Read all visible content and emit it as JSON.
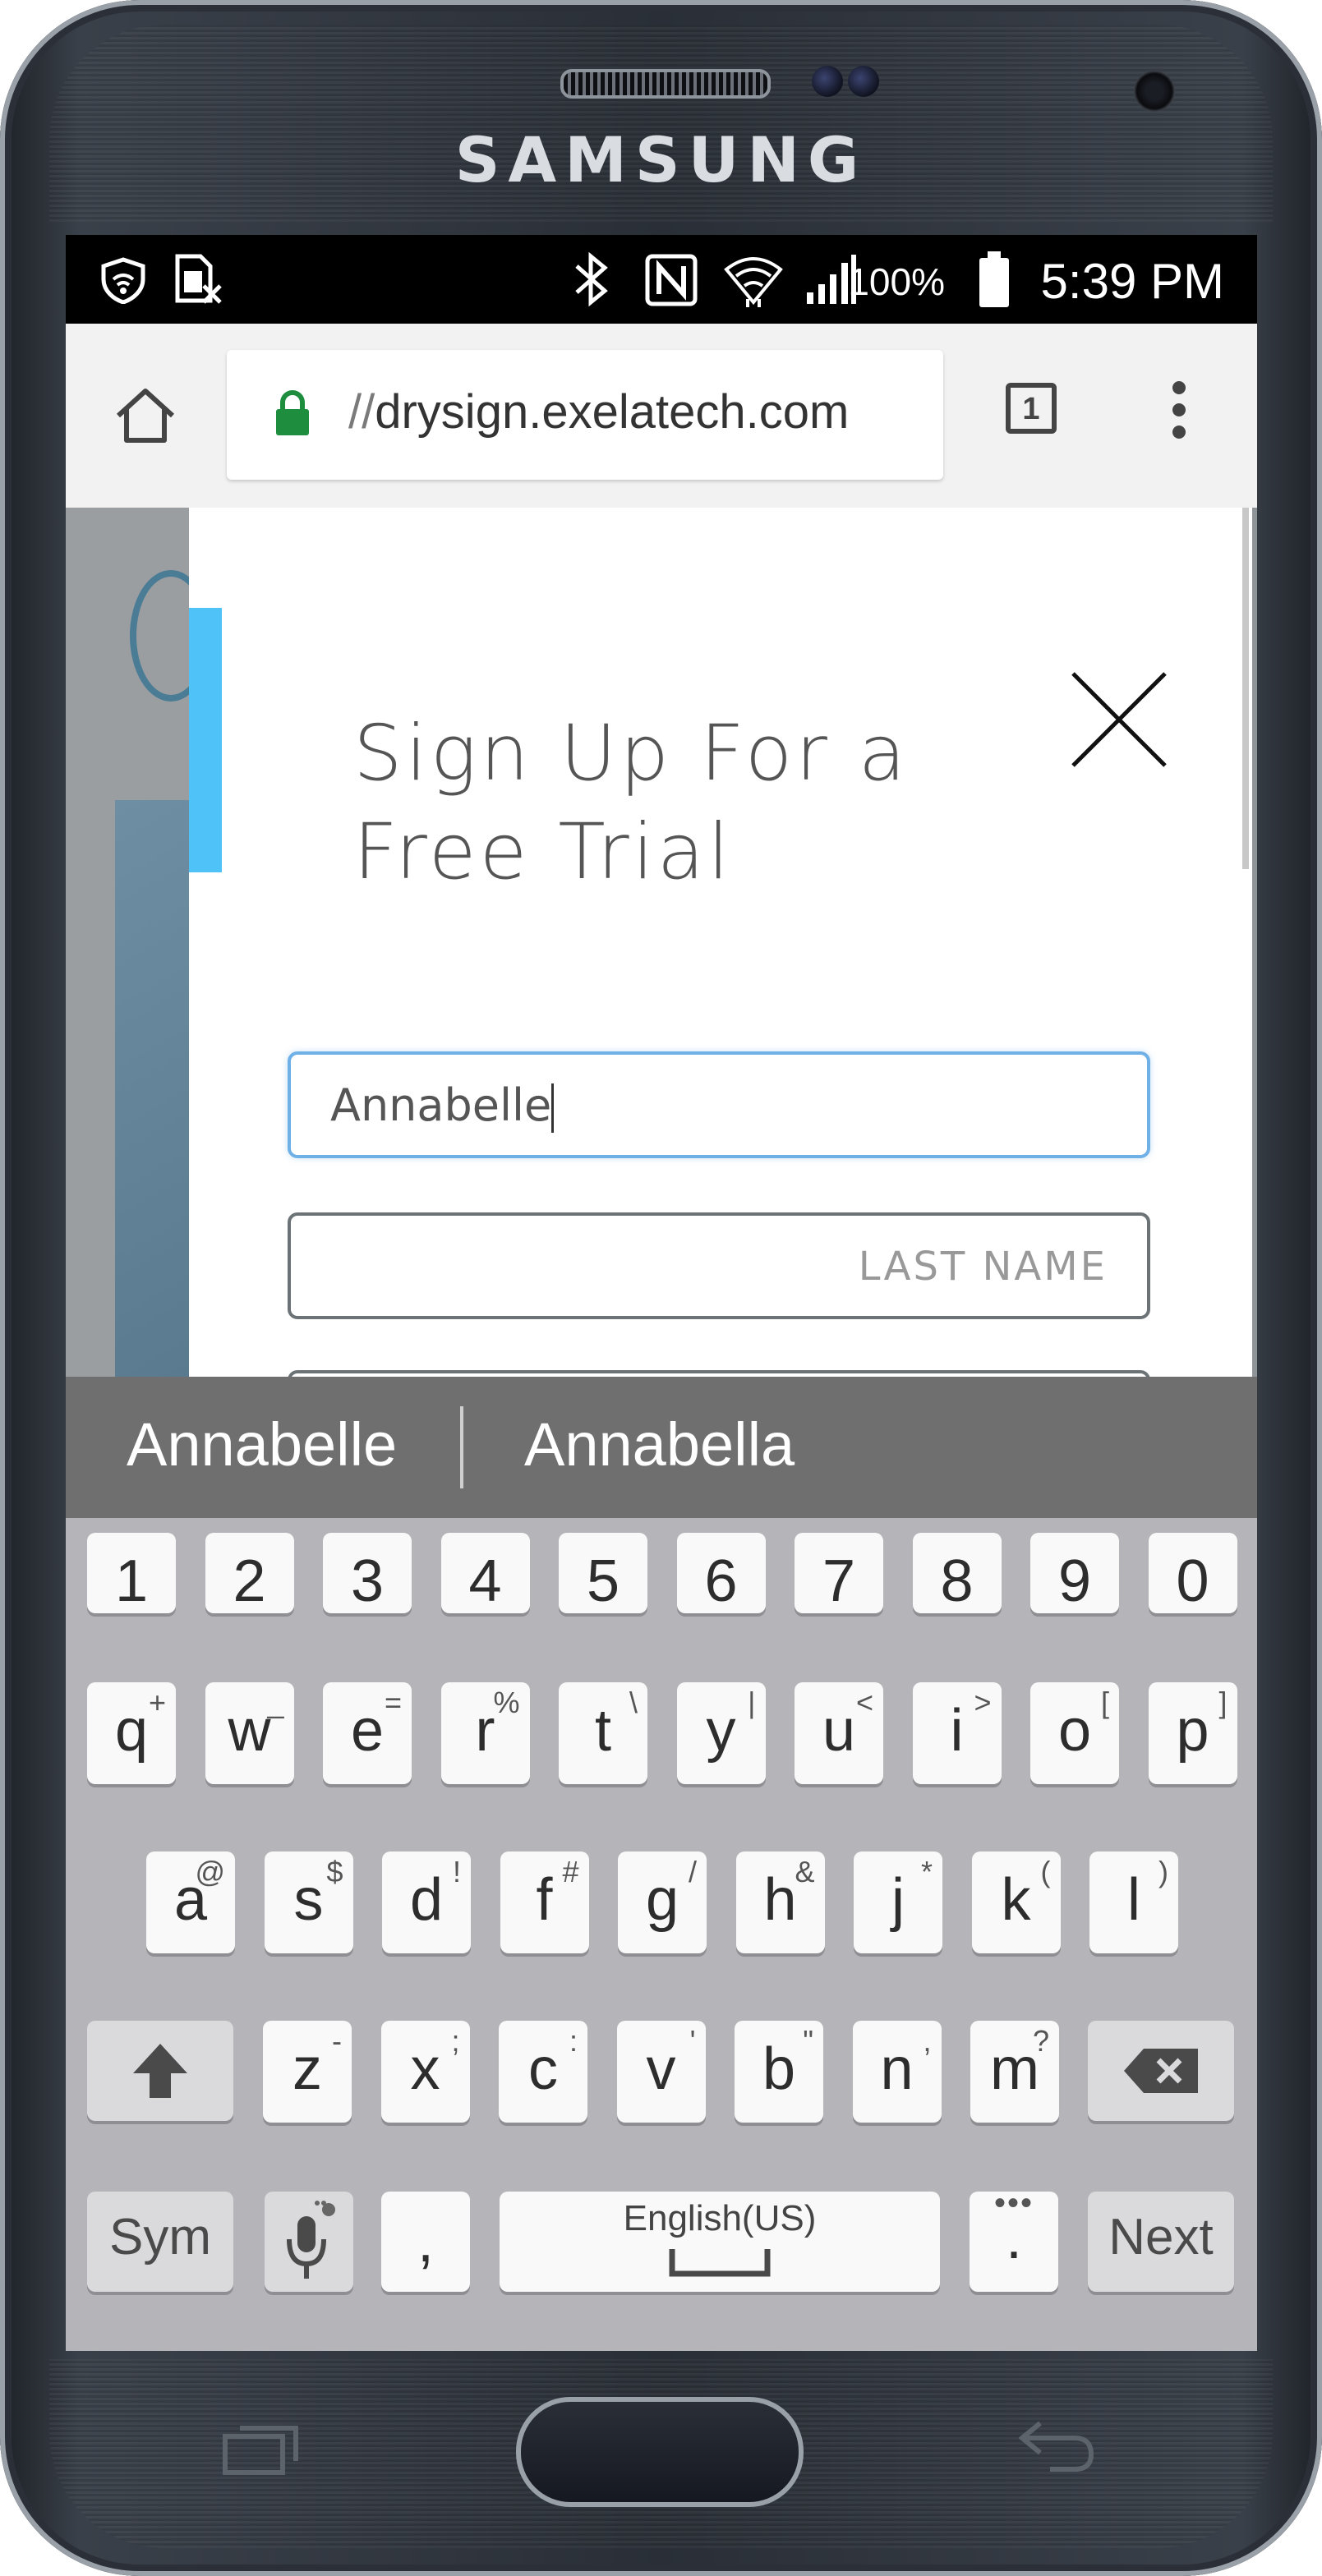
{
  "device": {
    "brand": "SAMSUNG"
  },
  "status_bar": {
    "battery": "100%",
    "time": "5:39 PM"
  },
  "browser": {
    "url_scheme": "//",
    "url_host": "drysign.exelatech.com",
    "tab_count": "1"
  },
  "modal": {
    "title_line1": "Sign Up For a",
    "title_line2": "Free Trial",
    "first_name_value": "Annabelle",
    "last_name_placeholder": "LAST NAME"
  },
  "suggestions": [
    "Annabelle",
    "Annabella"
  ],
  "keyboard": {
    "numbers": [
      "1",
      "2",
      "3",
      "4",
      "5",
      "6",
      "7",
      "8",
      "9",
      "0"
    ],
    "row1": [
      {
        "k": "q",
        "s": "+"
      },
      {
        "k": "w",
        "s": "_"
      },
      {
        "k": "e",
        "s": "="
      },
      {
        "k": "r",
        "s": "%"
      },
      {
        "k": "t",
        "s": "\\"
      },
      {
        "k": "y",
        "s": "|"
      },
      {
        "k": "u",
        "s": "<"
      },
      {
        "k": "i",
        "s": ">"
      },
      {
        "k": "o",
        "s": "["
      },
      {
        "k": "p",
        "s": "]"
      }
    ],
    "row2": [
      {
        "k": "a",
        "s": "@"
      },
      {
        "k": "s",
        "s": "$"
      },
      {
        "k": "d",
        "s": "!"
      },
      {
        "k": "f",
        "s": "#"
      },
      {
        "k": "g",
        "s": "/"
      },
      {
        "k": "h",
        "s": "&"
      },
      {
        "k": "j",
        "s": "*"
      },
      {
        "k": "k",
        "s": "("
      },
      {
        "k": "l",
        "s": ")"
      }
    ],
    "row3": [
      {
        "k": "z",
        "s": "-"
      },
      {
        "k": "x",
        "s": ";"
      },
      {
        "k": "c",
        "s": ":"
      },
      {
        "k": "v",
        "s": "'"
      },
      {
        "k": "b",
        "s": "\""
      },
      {
        "k": "n",
        "s": ","
      },
      {
        "k": "m",
        "s": "?"
      }
    ],
    "sym_label": "Sym",
    "comma": ",",
    "space_label": "English(US)",
    "period": ".",
    "next_label": "Next"
  }
}
